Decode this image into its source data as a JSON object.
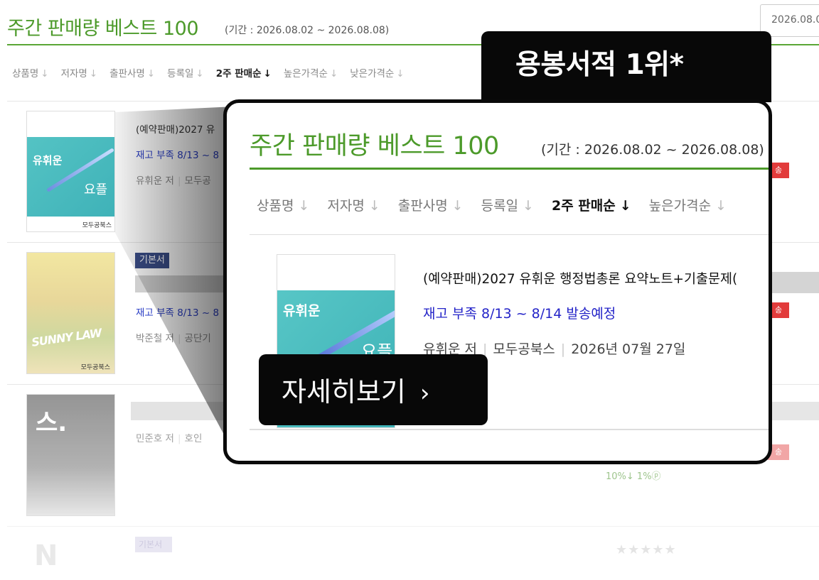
{
  "background": {
    "title": "주간 판매량 베스트 100",
    "period": "(기간 : 2026.08.02 ~ 2026.08.08)",
    "date_field_value": "2026.08.0",
    "sort_options": [
      {
        "label": "상품명",
        "active": false
      },
      {
        "label": "저자명",
        "active": false
      },
      {
        "label": "출판사명",
        "active": false
      },
      {
        "label": "등록일",
        "active": false
      },
      {
        "label": "2주 판매순",
        "active": true
      },
      {
        "label": "높은가격순",
        "active": false
      },
      {
        "label": "낮은가격순",
        "active": false
      }
    ],
    "arrow_glyph": "↓",
    "items": [
      {
        "title": "(예약판매)2027 유",
        "stock": "재고 부족 8/13 ~ 8",
        "meta": "유휘운 저",
        "publisher": "모두공",
        "cover_logo": "유휘운",
        "cover_text": "요플",
        "cover_footer": "모두공북스"
      },
      {
        "tag": "기본서",
        "stock": "재고 부족 8/13 ~ 8",
        "meta": "박준철 저",
        "publisher": "공단기",
        "cover_text": "SUNNY LAW",
        "cover_footer": "모두공북스"
      },
      {
        "meta": "민준호 저",
        "publisher": "호인",
        "cover_text": "스."
      }
    ],
    "fourth_tag": "기본서",
    "discount_text": "10%↓ 1%ⓟ",
    "stars": "★★★★★",
    "badge_text": "송"
  },
  "callout": {
    "label": "용봉서적 1위*"
  },
  "zoom": {
    "title": "주간 판매량 베스트 100",
    "period": "(기간 : 2026.08.02 ~ 2026.08.08)",
    "sort_options": [
      {
        "label": "상품명",
        "active": false
      },
      {
        "label": "저자명",
        "active": false
      },
      {
        "label": "출판사명",
        "active": false
      },
      {
        "label": "등록일",
        "active": false
      },
      {
        "label": "2주 판매순",
        "active": true
      },
      {
        "label": "높은가격순",
        "active": false
      }
    ],
    "product_title": "(예약판매)2027 유휘운 행정법총론 요약노트+기출문제(",
    "stock": "재고 부족 8/13 ~ 8/14 발송예정",
    "author": "유휘운 저",
    "publisher": "모두공북스",
    "pub_date": "2026년 07월 27일",
    "cover_logo": "유휘운",
    "cover_text": "요플",
    "detail_button": "자세히보기",
    "detail_chevron": "›"
  },
  "colors": {
    "accent_green": "#4c9a2a",
    "stock_blue": "#2424c8",
    "callout_bg": "#080808",
    "badge_red": "#e23b3b"
  }
}
